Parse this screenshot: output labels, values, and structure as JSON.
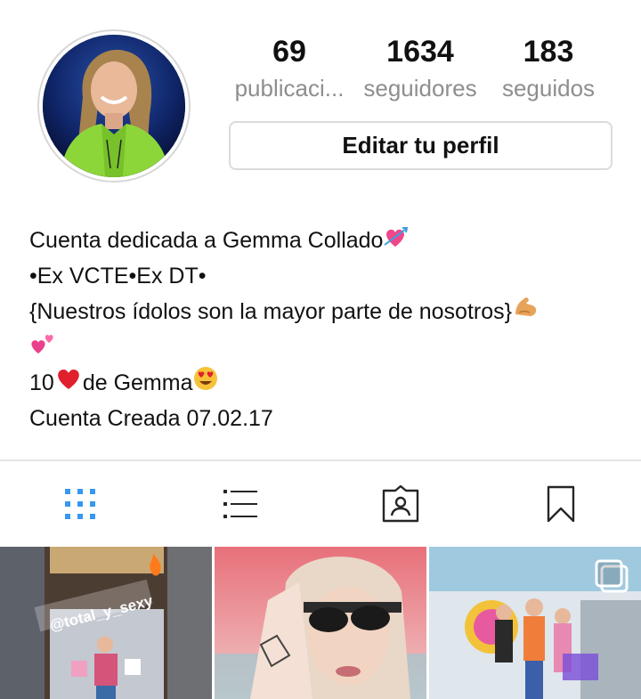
{
  "profile": {
    "stats": [
      {
        "value": "69",
        "label": "publicaci..."
      },
      {
        "value": "1634",
        "label": "seguidores"
      },
      {
        "value": "183",
        "label": "seguidos"
      }
    ],
    "edit_button": "Editar tu perfil"
  },
  "bio": {
    "line1": "Cuenta dedicada a Gemma Collado",
    "line2": "•Ex VCTE•Ex DT•",
    "line3": "{Nuestros ídolos son la mayor parte de nosotros}",
    "line5_a": "10",
    "line5_b": "de Gemma",
    "line6": "Cuenta Creada 07.02.17"
  },
  "tabs": [
    {
      "icon": "grid-icon",
      "active": true
    },
    {
      "icon": "list-icon",
      "active": false
    },
    {
      "icon": "tagged-icon",
      "active": false
    },
    {
      "icon": "bookmark-icon",
      "active": false
    }
  ],
  "posts": [
    {
      "overlay_text": "@total_y_sexy"
    },
    {
      "overlay_text": ""
    },
    {
      "overlay_text": "",
      "multiple": true
    }
  ],
  "colors": {
    "accent": "#3897f0",
    "muted": "#8e8e8e",
    "border": "#dbdbdb",
    "icon": "#262626"
  }
}
